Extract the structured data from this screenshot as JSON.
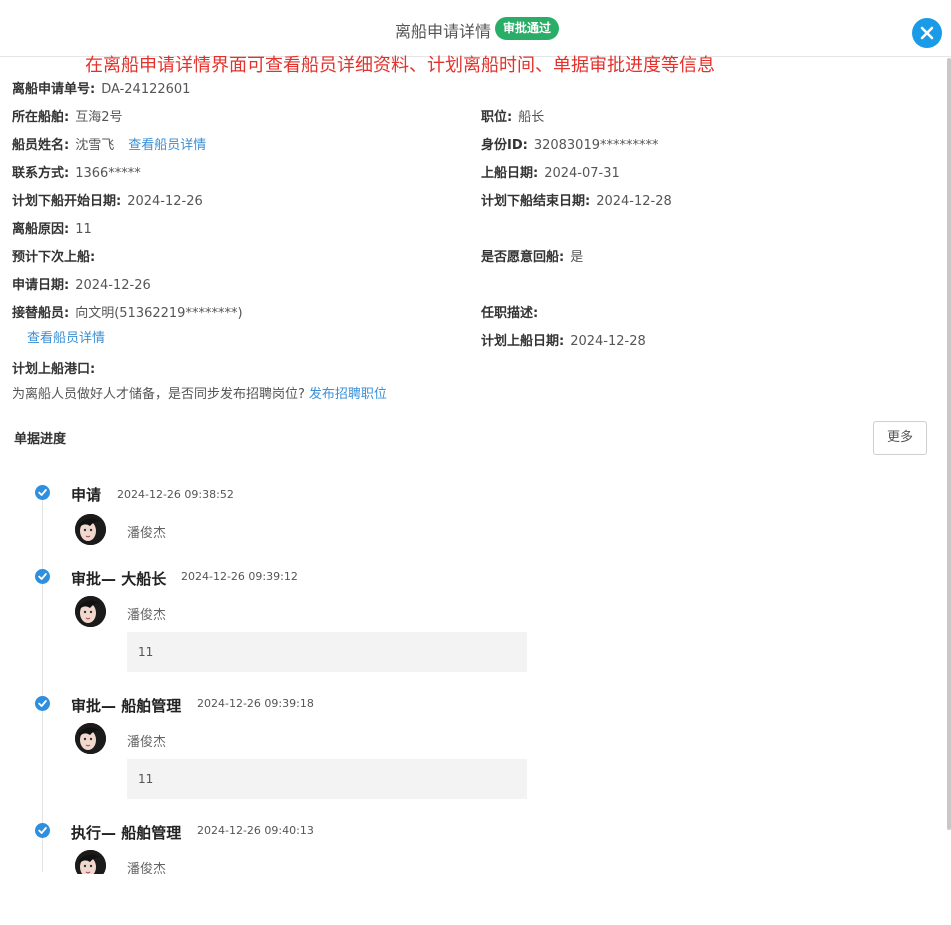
{
  "header": {
    "title": "离船申请详情",
    "status_badge": "审批通过",
    "status_color": "#2aae67",
    "close_icon": "close-icon"
  },
  "annotation": "在离船申请详情界面可查看船员详细资料、计划离船时间、单据审批进度等信息",
  "details": {
    "application_no": {
      "label": "离船申请单号:",
      "value": "DA-24122601"
    },
    "ship": {
      "label": "所在船舶:",
      "value": "互海2号"
    },
    "position": {
      "label": "职位:",
      "value": "船长"
    },
    "crew_name": {
      "label": "船员姓名:",
      "value": "沈雪飞",
      "link": "查看船员详情"
    },
    "id_no": {
      "label": "身份ID:",
      "value": "32083019*********"
    },
    "contact": {
      "label": "联系方式:",
      "value": "1366*****"
    },
    "board_date": {
      "label": "上船日期:",
      "value": "2024-07-31"
    },
    "plan_leave_start": {
      "label": "计划下船开始日期:",
      "value": "2024-12-26"
    },
    "plan_leave_end": {
      "label": "计划下船结束日期:",
      "value": "2024-12-28"
    },
    "leave_reason": {
      "label": "离船原因:",
      "value": "11"
    },
    "next_board": {
      "label": "预计下次上船:",
      "value": ""
    },
    "willing_return": {
      "label": "是否愿意回船:",
      "value": "是"
    },
    "apply_date": {
      "label": "申请日期:",
      "value": "2024-12-26"
    },
    "replacement": {
      "label": "接替船员:",
      "value": "向文明(51362219********)",
      "link": "查看船员详情"
    },
    "job_desc": {
      "label": "任职描述:",
      "value": ""
    },
    "plan_board_date": {
      "label": "计划上船日期:",
      "value": "2024-12-28"
    },
    "plan_board_port": {
      "label": "计划上船港口:",
      "value": ""
    }
  },
  "recruit": {
    "text": "为离船人员做好人才储备，是否同步发布招聘岗位?",
    "link": "发布招聘职位"
  },
  "progress": {
    "title": "单据进度",
    "more_label": "更多",
    "steps": [
      {
        "title": "申请",
        "time": "2024-12-26 09:38:52",
        "user": "潘俊杰",
        "comment": ""
      },
      {
        "title": "审批— 大船长",
        "time": "2024-12-26 09:39:12",
        "user": "潘俊杰",
        "comment": "11"
      },
      {
        "title": "审批— 船舶管理",
        "time": "2024-12-26 09:39:18",
        "user": "潘俊杰",
        "comment": "11"
      },
      {
        "title": "执行— 船舶管理",
        "time": "2024-12-26 09:40:13",
        "user": "潘俊杰",
        "comment": ""
      }
    ]
  },
  "colors": {
    "link": "#3a8fd6",
    "timeline_node": "#2f8fdf",
    "annotation": "#e4312b",
    "close_button": "#1a9be8"
  }
}
